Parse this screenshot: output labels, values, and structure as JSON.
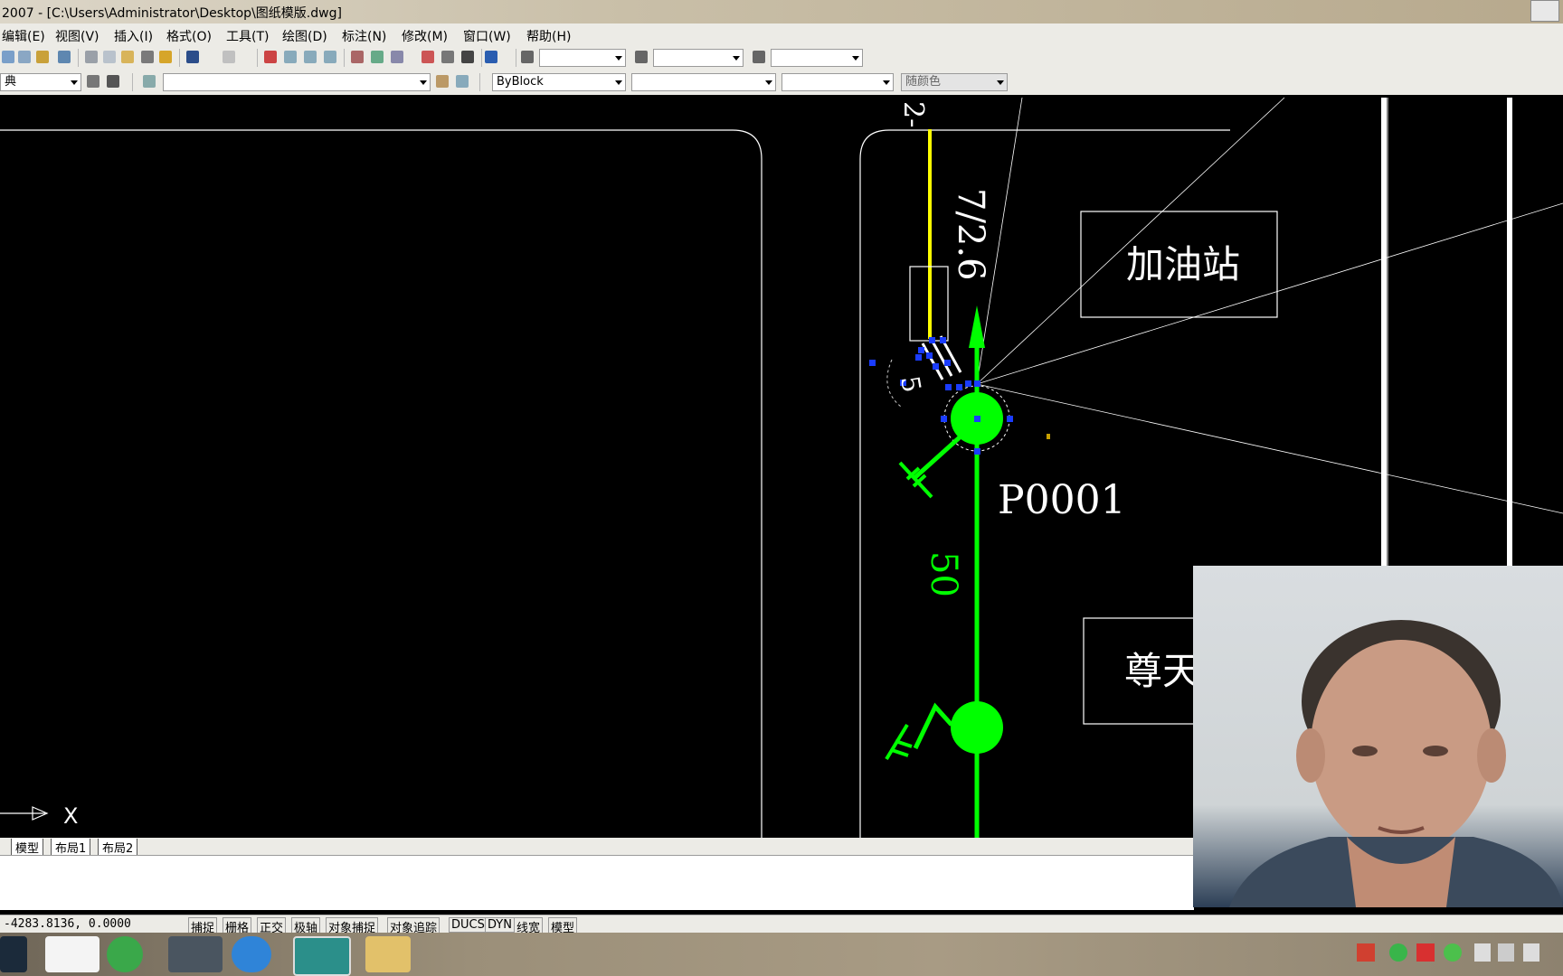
{
  "window": {
    "title": "2007 - [C:\\Users\\Administrator\\Desktop\\图纸模版.dwg]"
  },
  "menu": [
    "编辑(E)",
    "视图(V)",
    "插入(I)",
    "格式(O)",
    "工具(T)",
    "绘图(D)",
    "标注(N)",
    "修改(M)",
    "窗口(W)",
    "帮助(H)"
  ],
  "toolbar": {
    "style_combo": "典",
    "linetype_combo": "ByBlock",
    "color_combo": "随颜色"
  },
  "drawing": {
    "labels": {
      "gas_station": "加油站",
      "zuntian": "尊天",
      "pole_id": "P0001",
      "span": "50",
      "cable_spec": "7/2.6",
      "cable_top": "2-",
      "circle_num": "5",
      "axis_x": "X"
    },
    "colors": {
      "line": "#ffffff",
      "pole": "#00ff00",
      "cable": "#ffff00",
      "grip": "#1a3cff"
    }
  },
  "layout_tabs": [
    "模型",
    "布局1",
    "布局2"
  ],
  "status": {
    "coordinates": "-4283.8136, 0.0000",
    "buttons": [
      "捕捉",
      "栅格",
      "正交",
      "极轴",
      "对象捕捉",
      "对象追踪",
      "DUCS",
      "DYN",
      "线宽",
      "模型"
    ]
  },
  "taskbar": {
    "apps": [
      "video-icon",
      "baidu-netdisk-icon",
      "browser-icon",
      "wechat-icon",
      "bird-app-icon",
      "autocad-icon",
      "file-explorer-icon"
    ]
  }
}
